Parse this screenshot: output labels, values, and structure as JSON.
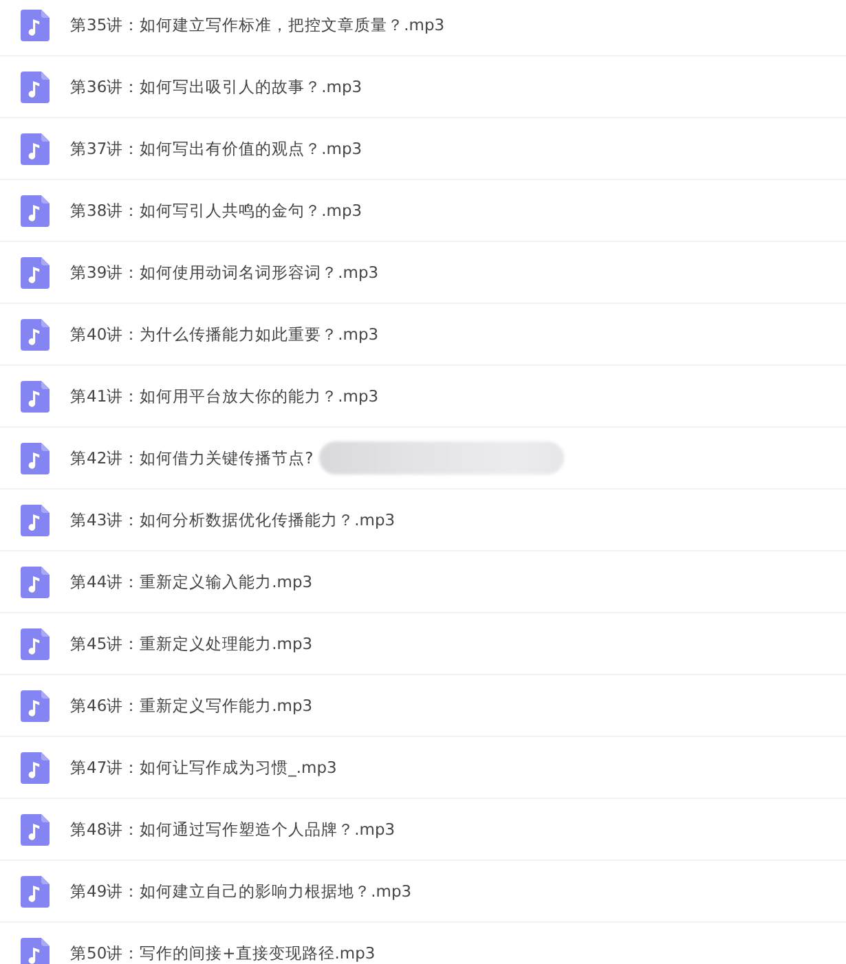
{
  "files": [
    {
      "name": "第35讲：如何建立写作标准，把控文章质量？.mp3",
      "redacted": false
    },
    {
      "name": "第36讲：如何写出吸引人的故事？.mp3",
      "redacted": false
    },
    {
      "name": "第37讲：如何写出有价值的观点？.mp3",
      "redacted": false
    },
    {
      "name": "第38讲：如何写引人共鸣的金句？.mp3",
      "redacted": false
    },
    {
      "name": "第39讲：如何使用动词名词形容词？.mp3",
      "redacted": false
    },
    {
      "name": "第40讲：为什么传播能力如此重要？.mp3",
      "redacted": false
    },
    {
      "name": "第41讲：如何用平台放大你的能力？.mp3",
      "redacted": false
    },
    {
      "name": "第42讲：如何借力关键传播节点?",
      "redacted": true
    },
    {
      "name": "第43讲：如何分析数据优化传播能力？.mp3",
      "redacted": false
    },
    {
      "name": "第44讲：重新定义输入能力.mp3",
      "redacted": false
    },
    {
      "name": "第45讲：重新定义处理能力.mp3",
      "redacted": false
    },
    {
      "name": "第46讲：重新定义写作能力.mp3",
      "redacted": false
    },
    {
      "name": "第47讲：如何让写作成为习惯_.mp3",
      "redacted": false
    },
    {
      "name": "第48讲：如何通过写作塑造个人品牌？.mp3",
      "redacted": false
    },
    {
      "name": "第49讲：如何建立自己的影响力根据地？.mp3",
      "redacted": false
    },
    {
      "name": "第50讲：写作的间接+直接变现路径.mp3",
      "redacted": false
    }
  ]
}
